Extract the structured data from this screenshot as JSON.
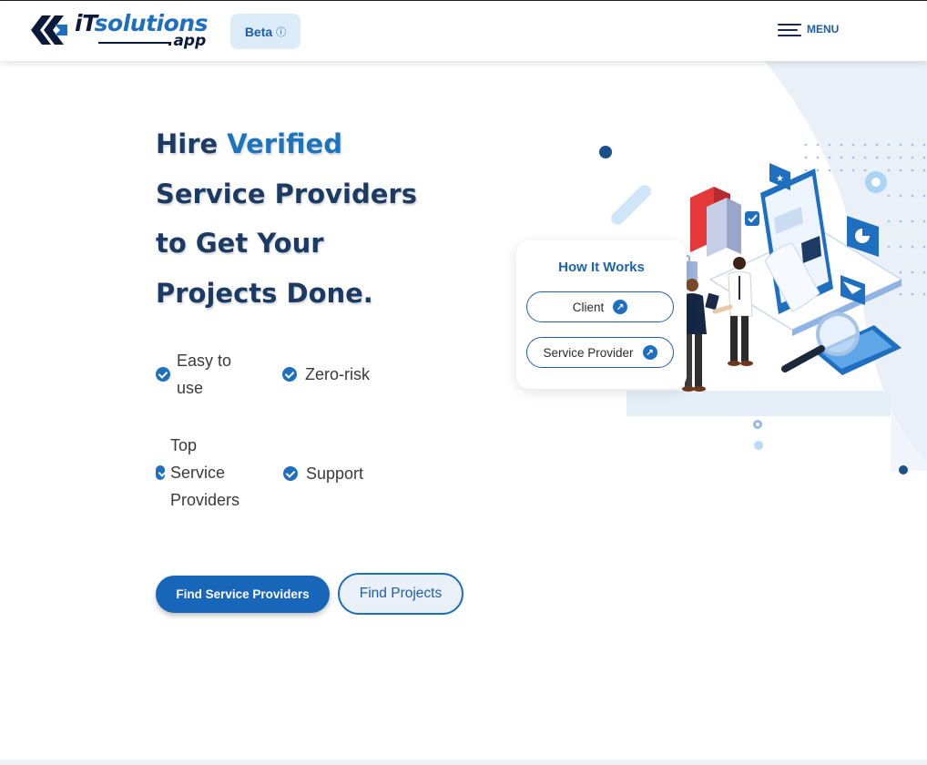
{
  "header": {
    "logo": {
      "brand_prefix": "iT",
      "brand_main": "solutions",
      "brand_suffix": ".app"
    },
    "beta_label": "Beta",
    "beta_info_icon": "info-icon",
    "menu_label": "MENU"
  },
  "hero": {
    "title_part1": "Hire ",
    "title_accent": "Verified",
    "title_part2": "Service Providers",
    "title_part3": "to Get Your",
    "title_part4": "Projects Done.",
    "features": [
      {
        "label": "Easy to use"
      },
      {
        "label": "Zero-risk"
      },
      {
        "label": "Top Service Providers"
      },
      {
        "label": "Support"
      }
    ],
    "primary_button": "Find Service Providers",
    "secondary_button": "Find Projects"
  },
  "how_it_works": {
    "title": "How It Works",
    "options": [
      {
        "label": "Client"
      },
      {
        "label": "Service Provider"
      }
    ]
  },
  "colors": {
    "brand_blue": "#1e6fbf",
    "navy": "#1b3a64",
    "beta_bg": "#dcebf8"
  }
}
